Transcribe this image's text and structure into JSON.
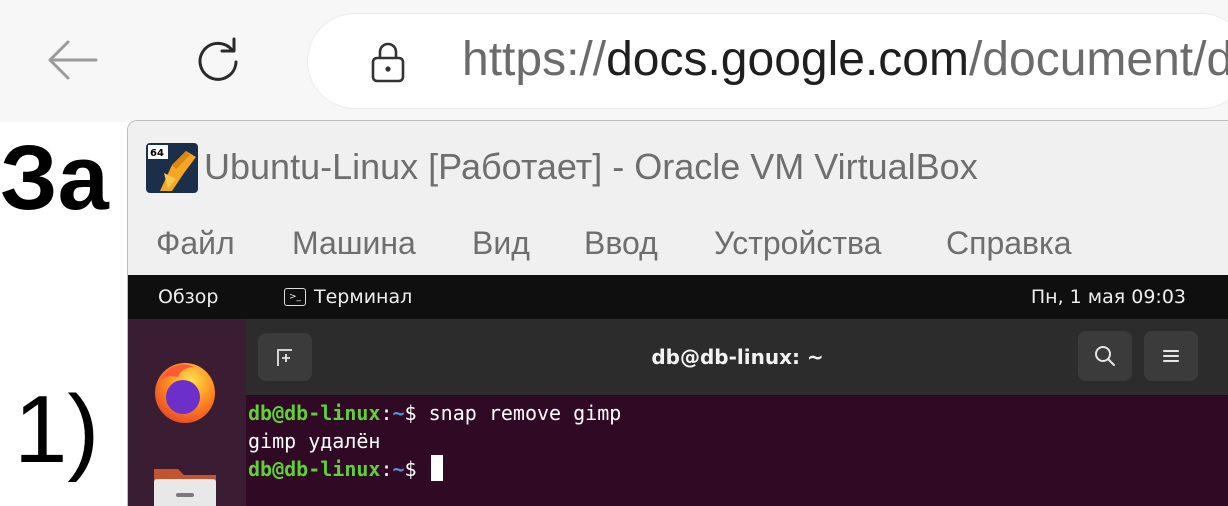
{
  "browser": {
    "url_scheme": "https://",
    "url_domain": "docs.google.com",
    "url_path": "/document/d/"
  },
  "document": {
    "heading_fragment": "За",
    "list_number": "1)"
  },
  "vbox": {
    "title": "Ubuntu-Linux [Работает] - Oracle VM VirtualBox",
    "menu": [
      "Файл",
      "Машина",
      "Вид",
      "Ввод",
      "Устройства",
      "Справка"
    ],
    "app_icon_badge": "64"
  },
  "gnome": {
    "overview": "Обзор",
    "active_app": "Терминал",
    "clock": "Пн, 1 мая  09:03"
  },
  "terminal": {
    "title": "db@db-linux: ~",
    "lines": [
      {
        "user": "db@db-linux",
        "sep": ":",
        "path": "~",
        "prompt": "$ ",
        "command": "snap remove gimp"
      },
      {
        "output": "gimp удалён"
      },
      {
        "user": "db@db-linux",
        "sep": ":",
        "path": "~",
        "prompt": "$ ",
        "command": ""
      }
    ]
  },
  "icons": {
    "back": "arrow-left-icon",
    "reload": "reload-icon",
    "lock": "lock-icon",
    "vbox": "virtualbox-icon",
    "new_tab": "new-tab-icon",
    "search": "search-icon",
    "menu": "hamburger-menu-icon",
    "firefox": "firefox-icon",
    "files": "folder-icon"
  },
  "colors": {
    "terminal_bg": "#300a24",
    "prompt_user": "#5fd038",
    "prompt_path": "#5b8fd9",
    "gnome_topbar": "#0f0f0f",
    "dock_bg": "#3a1d33"
  }
}
